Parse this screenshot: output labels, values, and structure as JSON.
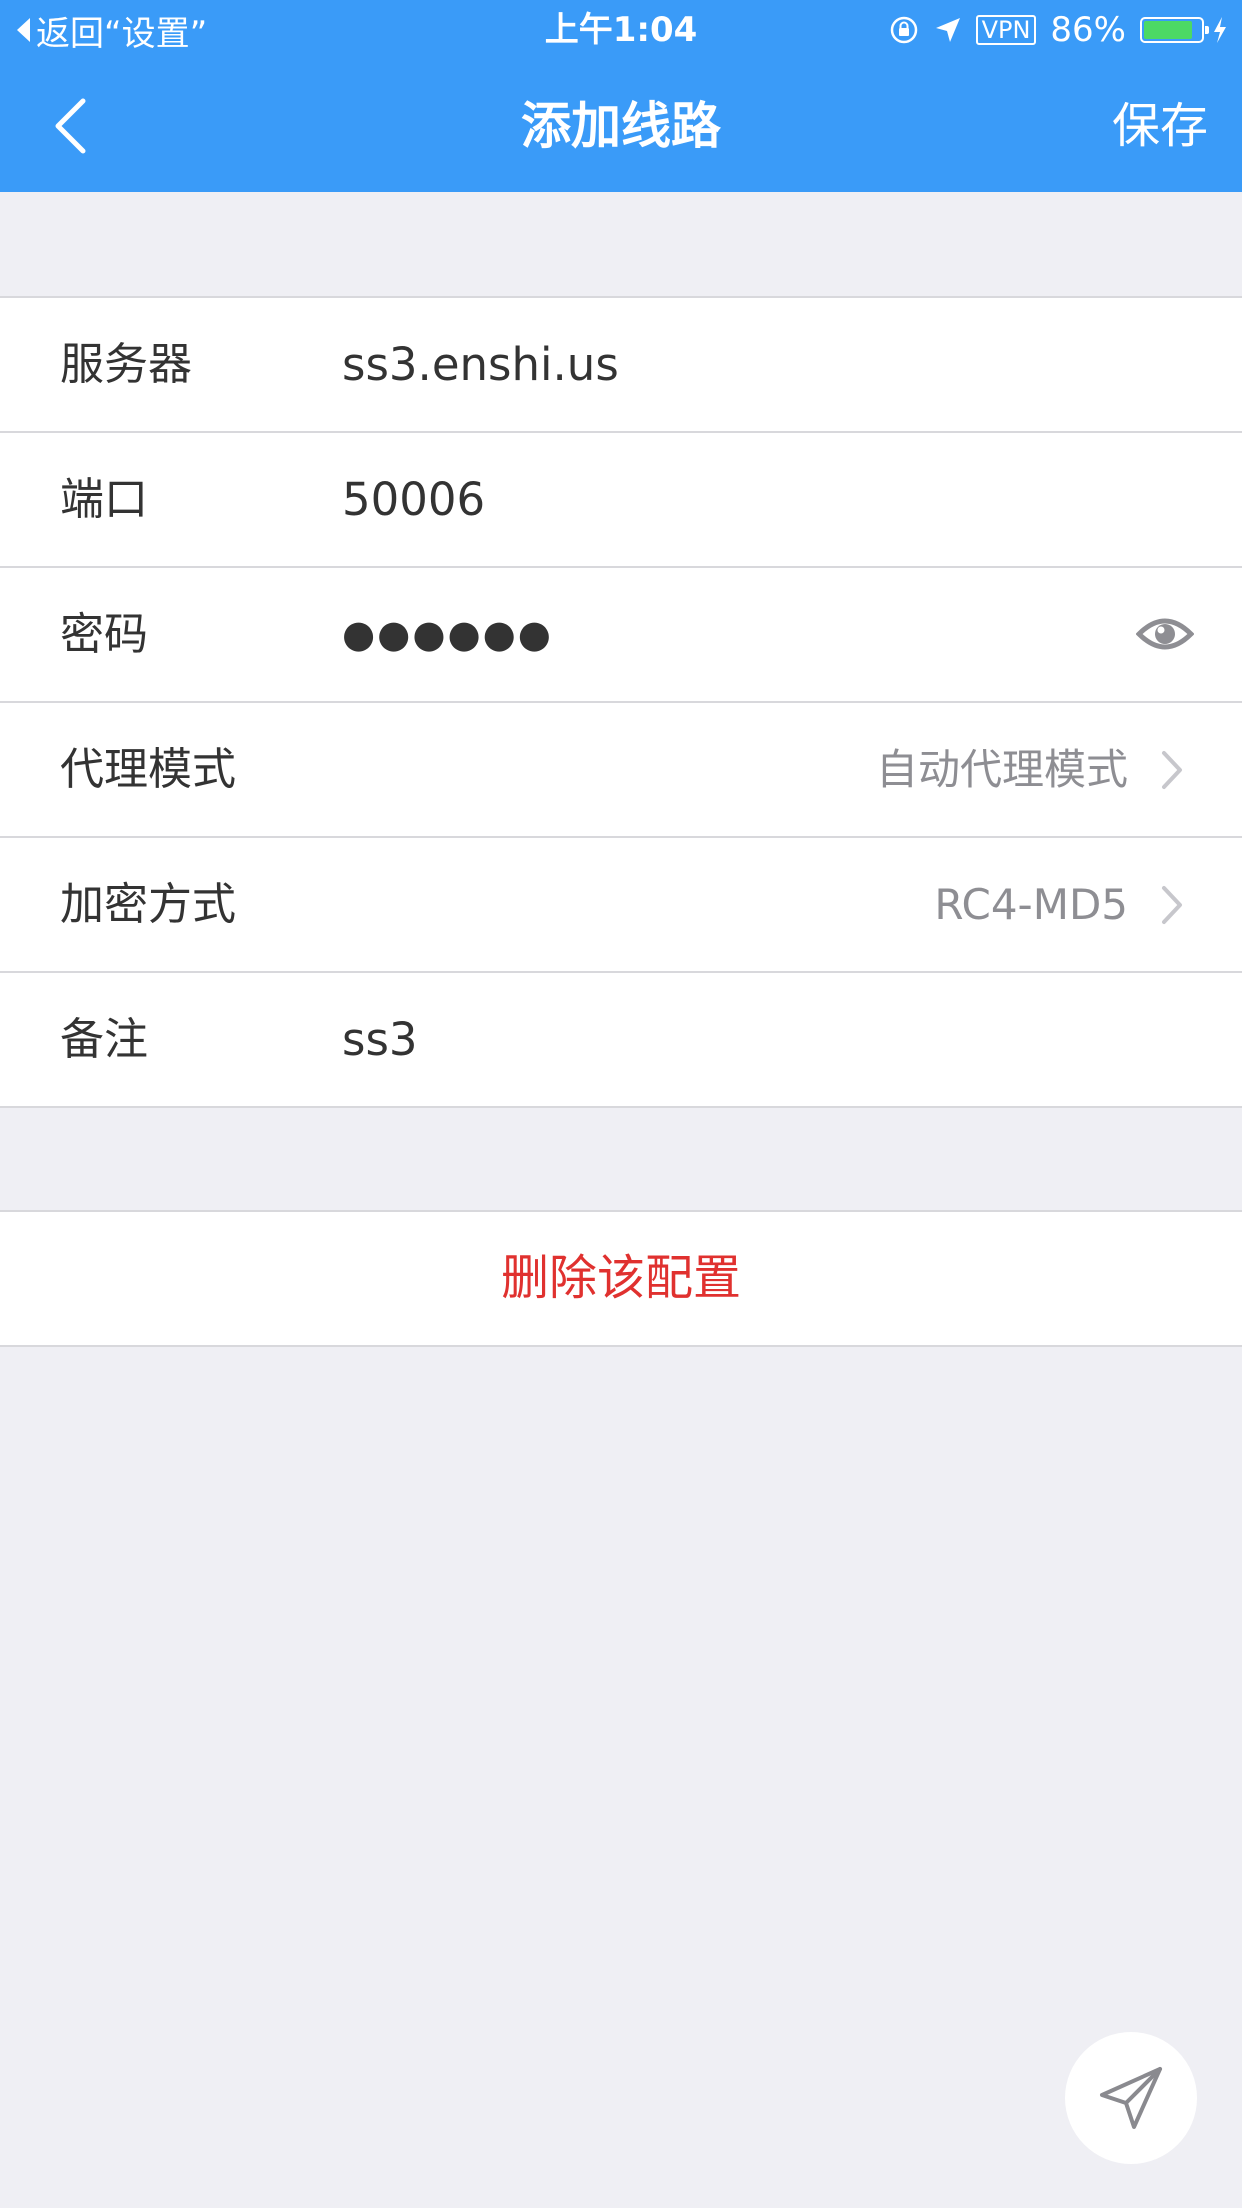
{
  "status_bar": {
    "back_text": "返回“设置”",
    "time": "上午1:04",
    "vpn": "VPN",
    "battery_percent": "86%",
    "battery_level": 0.86
  },
  "nav": {
    "title": "添加线路",
    "save_label": "保存"
  },
  "form": {
    "server": {
      "label": "服务器",
      "value": "ss3.enshi.us"
    },
    "port": {
      "label": "端口",
      "value": "50006"
    },
    "password": {
      "label": "密码",
      "value": "●●●●●●"
    },
    "proxy_mode": {
      "label": "代理模式",
      "value": "自动代理模式"
    },
    "encryption": {
      "label": "加密方式",
      "value": "RC4-MD5"
    },
    "remark": {
      "label": "备注",
      "value": "ss3"
    }
  },
  "actions": {
    "delete_label": "删除该配置"
  },
  "colors": {
    "accent": "#3a9bf8",
    "danger": "#e0312f",
    "battery": "#4cd964",
    "background": "#efeff4"
  },
  "icons": {
    "back": "chevron-left-icon",
    "eye": "eye-icon",
    "chevron": "chevron-right-icon",
    "fab": "paper-plane-icon"
  }
}
